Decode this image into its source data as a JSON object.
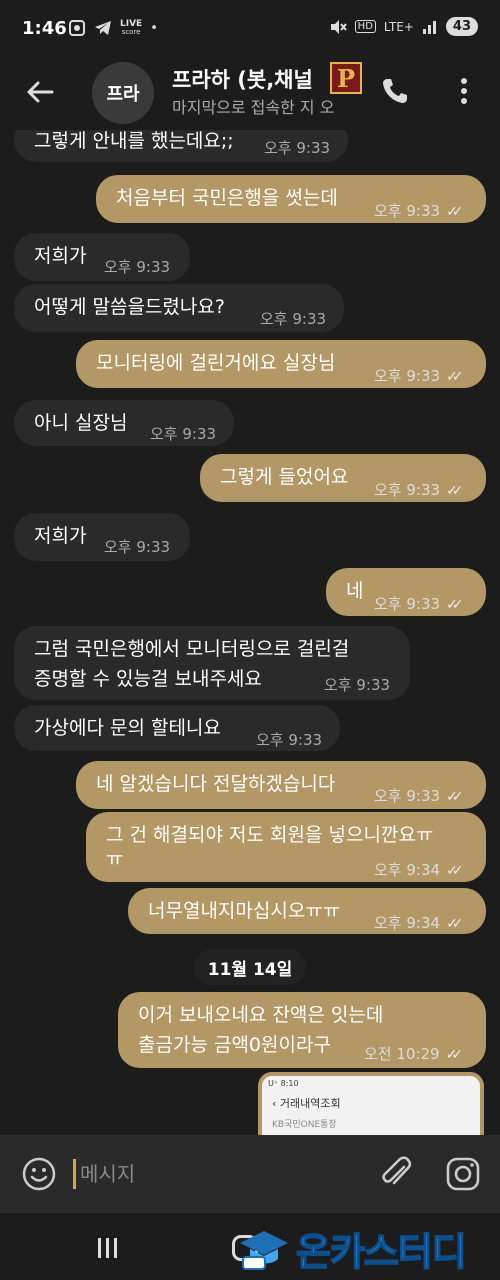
{
  "status_bar": {
    "time": "1:46",
    "live_label": "LIVE",
    "score_label": "score",
    "dot": "•",
    "network": "LTE+",
    "hd": "HD",
    "battery": "43"
  },
  "header": {
    "avatar_text": "프라",
    "title": "프라하 (봇,채널",
    "subtitle": "마지막으로 접속한 지 오",
    "badge_letter": "P"
  },
  "messages": [
    {
      "dir": "in",
      "text": "그렇게 안내를 했는데요;;",
      "time": "오후 9:33"
    },
    {
      "dir": "out",
      "text": "처음부터 국민은행을 썻는데",
      "time": "오후 9:33"
    },
    {
      "dir": "in",
      "text": "저희가",
      "time": "오후 9:33"
    },
    {
      "dir": "in",
      "text": "어떻게 말씀을드렸나요?",
      "time": "오후 9:33"
    },
    {
      "dir": "out",
      "text": "모니터링에 걸린거에요 실장님",
      "time": "오후 9:33"
    },
    {
      "dir": "in",
      "text": "아니 실장님",
      "time": "오후 9:33"
    },
    {
      "dir": "out",
      "text": "그렇게 들었어요",
      "time": "오후 9:33"
    },
    {
      "dir": "in",
      "text": "저희가",
      "time": "오후 9:33"
    },
    {
      "dir": "out",
      "text": "네",
      "time": "오후 9:33"
    },
    {
      "dir": "in",
      "line1": "그럼 국민은행에서 모니터링으로 걸린걸",
      "line2": "증명할 수 있능걸 보내주세요",
      "time": "오후 9:33"
    },
    {
      "dir": "in",
      "text": "가상에다 문의 할테니요",
      "time": "오후 9:33"
    },
    {
      "dir": "out",
      "text": "네 알겠습니다 전달하겠습니다",
      "time": "오후 9:33"
    },
    {
      "dir": "out",
      "line1": "그 건 해결되야 저도 회원을 넣으니깐요ㅠ",
      "line2": "ㅠ",
      "time": "오후 9:34"
    },
    {
      "dir": "out",
      "text": "너무열내지마십시오ㅠㅠ",
      "time": "오후 9:34"
    },
    {
      "dir": "out",
      "line1": "이거 보내오네요 잔액은 잇는데",
      "line2": "출금가능 금액0원이라구",
      "time": "오전 10:29"
    }
  ],
  "date_divider": "11월 14일",
  "thumbnail": {
    "status": "U⁺ 8:10",
    "title": "거래내역조회",
    "sub": "KB국민ONE통장"
  },
  "input": {
    "placeholder": "메시지"
  },
  "watermark": {
    "text": "온카스터디"
  },
  "colors": {
    "background": "#1c1c1c",
    "incoming_bubble": "#2a2a2a",
    "outgoing_bubble": "#b39866",
    "accent_cursor": "#d9a441"
  }
}
